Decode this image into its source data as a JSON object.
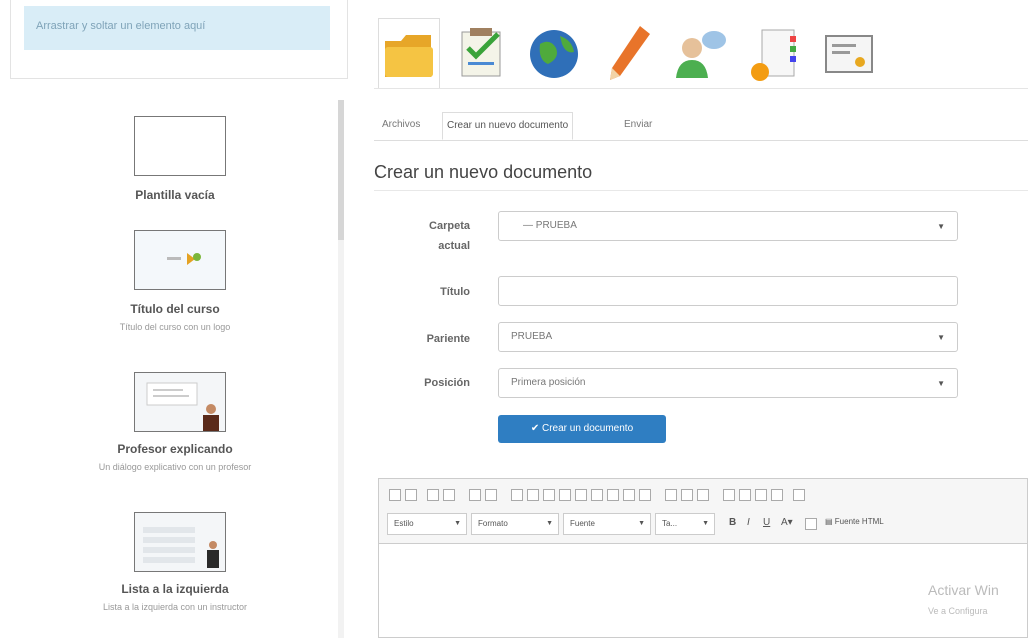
{
  "dropzone": {
    "text": "Arrastrar y soltar un elemento aquí"
  },
  "templates": [
    {
      "title": "Plantilla vacía",
      "description": ""
    },
    {
      "title": "Título del curso",
      "description": "Título del curso con un logo"
    },
    {
      "title": "Profesor explicando",
      "description": "Un diálogo explicativo con un profesor"
    },
    {
      "title": "Lista a la izquierda",
      "description": "Lista a la izquierda con un instructor"
    }
  ],
  "toolbar": {
    "icons": [
      "folder-icon",
      "checklist-icon",
      "globe-icon",
      "pencil-icon",
      "users-icon",
      "document-settings-icon",
      "certificate-icon"
    ]
  },
  "tabs": [
    "Archivos",
    "Crear un nuevo documento",
    "Enviar"
  ],
  "page_title": "Crear un nuevo documento",
  "form": {
    "folder_label_1": "Carpeta",
    "folder_label_2": "actual",
    "folder_value": "— PRUEBA",
    "title_label": "Título",
    "title_value": "",
    "parent_label": "Pariente",
    "parent_value": "PRUEBA",
    "position_label": "Posición",
    "position_value": "Primera posición",
    "submit_label": "✔ Crear un documento"
  },
  "editor": {
    "style_select": "Estilo",
    "format_select": "Formato",
    "font_select": "Fuente",
    "size_select": "Ta...",
    "bold": "B",
    "italic": "I",
    "underline": "U",
    "source_label": "Fuente HTML"
  },
  "watermark": {
    "line1": "Activar Win",
    "line2": "Ve a Configura"
  }
}
